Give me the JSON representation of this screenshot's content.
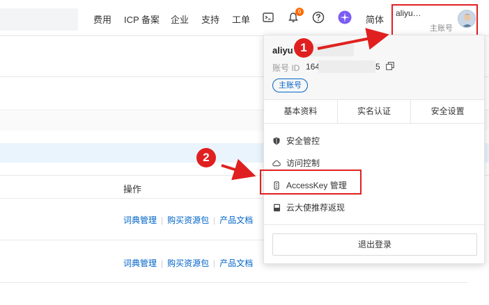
{
  "topbar": {
    "nav": [
      "费用",
      "ICP 备案",
      "企业",
      "支持",
      "工单"
    ],
    "notification_count": "6",
    "lang": "简体",
    "account_name": "aliyu…",
    "account_role": "主账号"
  },
  "table": {
    "column_header": "操作",
    "row_links": [
      "词典管理",
      "购买资源包",
      "产品文档"
    ]
  },
  "dropdown": {
    "name": "aliyu",
    "id_label": "账号 ID",
    "id_value": "164",
    "id_tail": "5",
    "role_tag": "主账号",
    "tabs": [
      "基本资料",
      "实名认证",
      "安全设置"
    ],
    "items": [
      "安全管控",
      "访问控制",
      "AccessKey 管理",
      "云大使推荐返现"
    ],
    "logout": "退出登录"
  },
  "annotations": {
    "step1": "1",
    "step2": "2"
  },
  "colors": {
    "accent_blue": "#0064c8",
    "annotation_red": "#e02020",
    "badge_orange": "#ff6a00"
  }
}
